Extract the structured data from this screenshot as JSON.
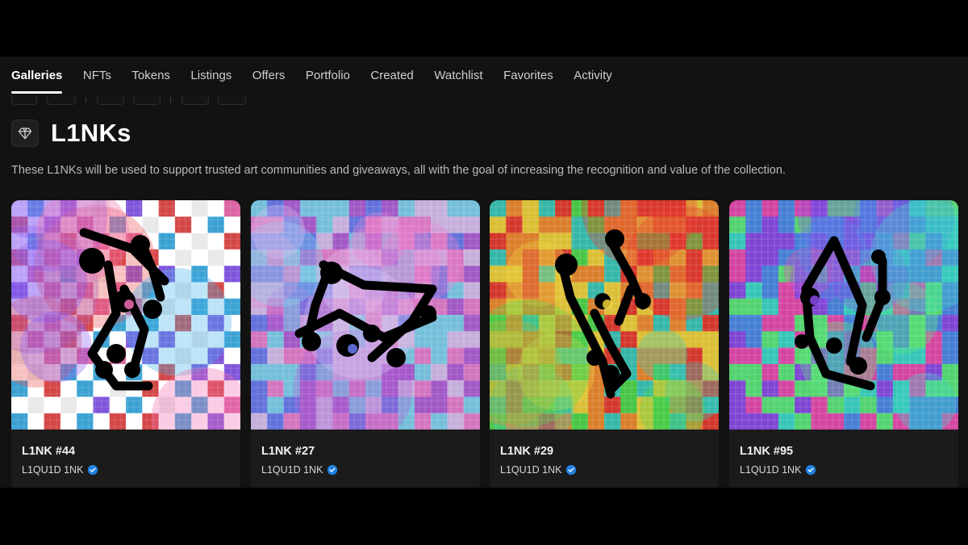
{
  "tabs": [
    {
      "label": "Galleries",
      "active": true
    },
    {
      "label": "NFTs"
    },
    {
      "label": "Tokens"
    },
    {
      "label": "Listings"
    },
    {
      "label": "Offers"
    },
    {
      "label": "Portfolio"
    },
    {
      "label": "Created"
    },
    {
      "label": "Watchlist"
    },
    {
      "label": "Favorites"
    },
    {
      "label": "Activity"
    }
  ],
  "gallery": {
    "icon": "diamond-icon",
    "title": "L1NKs",
    "description": "These L1NKs will be used to support trusted art communities and giveaways, all with the goal of increasing the recognition and value of the collection."
  },
  "cards": [
    {
      "name": "L1NK #44",
      "creator": "L1QU1D 1NK",
      "verified": true,
      "palette": [
        "#e84b4b",
        "#f06bb0",
        "#8a5cf0",
        "#3fb0e8",
        "#ffffff"
      ]
    },
    {
      "name": "L1NK #27",
      "creator": "L1QU1D 1NK",
      "verified": true,
      "palette": [
        "#b05fd8",
        "#6a7bf0",
        "#e87fd0",
        "#7fd0f0",
        "#d8c0f0"
      ]
    },
    {
      "name": "L1NK #29",
      "creator": "L1QU1D 1NK",
      "verified": true,
      "palette": [
        "#e83a2e",
        "#f0d23a",
        "#4ed84a",
        "#38c8b8",
        "#f08a2e"
      ]
    },
    {
      "name": "L1NK #95",
      "creator": "L1QU1D 1NK",
      "verified": true,
      "palette": [
        "#3ad8c8",
        "#8a4ae8",
        "#e84ab0",
        "#4a8ae8",
        "#5ae87a"
      ]
    }
  ],
  "colors": {
    "background": "#121212",
    "card": "#1b1b1b",
    "verified_badge": "#2081e2"
  }
}
